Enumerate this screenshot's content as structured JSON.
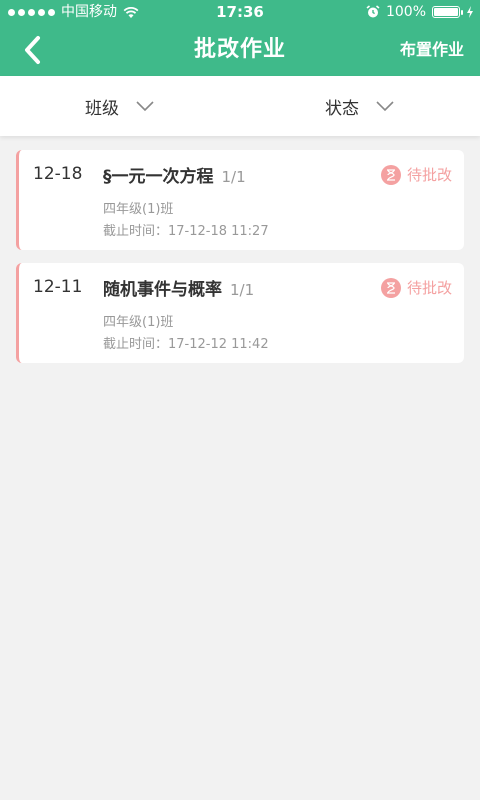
{
  "status_bar": {
    "carrier": "中国移动",
    "time": "17:36",
    "battery": "100%"
  },
  "nav": {
    "title": "批改作业",
    "action": "布置作业"
  },
  "filters": [
    {
      "label": "班级"
    },
    {
      "label": "状态"
    }
  ],
  "assignments": [
    {
      "date": "12-18",
      "title": "§一元一次方程",
      "count": "1/1",
      "class_name": "四年级(1)班",
      "deadline": "截止时间：17-12-18 11:27",
      "status": "待批改"
    },
    {
      "date": "12-11",
      "title": "随机事件与概率",
      "count": "1/1",
      "class_name": "四年级(1)班",
      "deadline": "截止时间：17-12-12 11:42",
      "status": "待批改"
    }
  ],
  "colors": {
    "header": "#3fba8a",
    "pending": "#f4a1a1",
    "background": "#f2f2f2"
  }
}
